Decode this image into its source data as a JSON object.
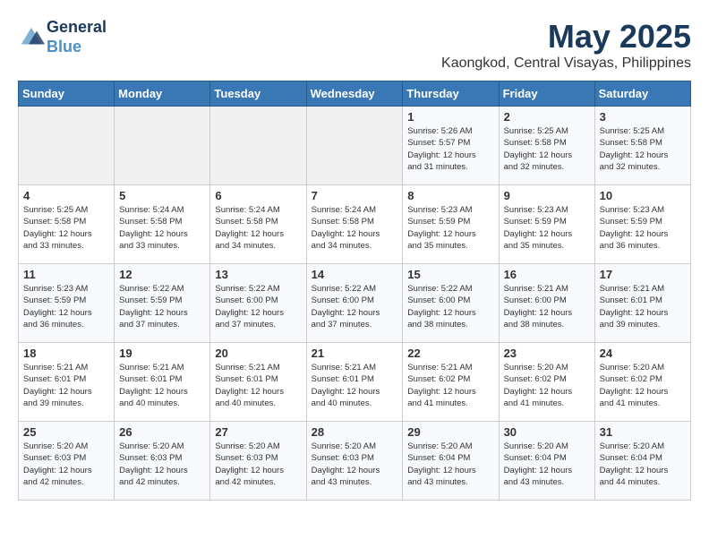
{
  "header": {
    "logo_line1": "General",
    "logo_line2": "Blue",
    "month_title": "May 2025",
    "location": "Kaongkod, Central Visayas, Philippines"
  },
  "weekdays": [
    "Sunday",
    "Monday",
    "Tuesday",
    "Wednesday",
    "Thursday",
    "Friday",
    "Saturday"
  ],
  "weeks": [
    [
      {
        "day": "",
        "info": ""
      },
      {
        "day": "",
        "info": ""
      },
      {
        "day": "",
        "info": ""
      },
      {
        "day": "",
        "info": ""
      },
      {
        "day": "1",
        "info": "Sunrise: 5:26 AM\nSunset: 5:57 PM\nDaylight: 12 hours\nand 31 minutes."
      },
      {
        "day": "2",
        "info": "Sunrise: 5:25 AM\nSunset: 5:58 PM\nDaylight: 12 hours\nand 32 minutes."
      },
      {
        "day": "3",
        "info": "Sunrise: 5:25 AM\nSunset: 5:58 PM\nDaylight: 12 hours\nand 32 minutes."
      }
    ],
    [
      {
        "day": "4",
        "info": "Sunrise: 5:25 AM\nSunset: 5:58 PM\nDaylight: 12 hours\nand 33 minutes."
      },
      {
        "day": "5",
        "info": "Sunrise: 5:24 AM\nSunset: 5:58 PM\nDaylight: 12 hours\nand 33 minutes."
      },
      {
        "day": "6",
        "info": "Sunrise: 5:24 AM\nSunset: 5:58 PM\nDaylight: 12 hours\nand 34 minutes."
      },
      {
        "day": "7",
        "info": "Sunrise: 5:24 AM\nSunset: 5:58 PM\nDaylight: 12 hours\nand 34 minutes."
      },
      {
        "day": "8",
        "info": "Sunrise: 5:23 AM\nSunset: 5:59 PM\nDaylight: 12 hours\nand 35 minutes."
      },
      {
        "day": "9",
        "info": "Sunrise: 5:23 AM\nSunset: 5:59 PM\nDaylight: 12 hours\nand 35 minutes."
      },
      {
        "day": "10",
        "info": "Sunrise: 5:23 AM\nSunset: 5:59 PM\nDaylight: 12 hours\nand 36 minutes."
      }
    ],
    [
      {
        "day": "11",
        "info": "Sunrise: 5:23 AM\nSunset: 5:59 PM\nDaylight: 12 hours\nand 36 minutes."
      },
      {
        "day": "12",
        "info": "Sunrise: 5:22 AM\nSunset: 5:59 PM\nDaylight: 12 hours\nand 37 minutes."
      },
      {
        "day": "13",
        "info": "Sunrise: 5:22 AM\nSunset: 6:00 PM\nDaylight: 12 hours\nand 37 minutes."
      },
      {
        "day": "14",
        "info": "Sunrise: 5:22 AM\nSunset: 6:00 PM\nDaylight: 12 hours\nand 37 minutes."
      },
      {
        "day": "15",
        "info": "Sunrise: 5:22 AM\nSunset: 6:00 PM\nDaylight: 12 hours\nand 38 minutes."
      },
      {
        "day": "16",
        "info": "Sunrise: 5:21 AM\nSunset: 6:00 PM\nDaylight: 12 hours\nand 38 minutes."
      },
      {
        "day": "17",
        "info": "Sunrise: 5:21 AM\nSunset: 6:01 PM\nDaylight: 12 hours\nand 39 minutes."
      }
    ],
    [
      {
        "day": "18",
        "info": "Sunrise: 5:21 AM\nSunset: 6:01 PM\nDaylight: 12 hours\nand 39 minutes."
      },
      {
        "day": "19",
        "info": "Sunrise: 5:21 AM\nSunset: 6:01 PM\nDaylight: 12 hours\nand 40 minutes."
      },
      {
        "day": "20",
        "info": "Sunrise: 5:21 AM\nSunset: 6:01 PM\nDaylight: 12 hours\nand 40 minutes."
      },
      {
        "day": "21",
        "info": "Sunrise: 5:21 AM\nSunset: 6:01 PM\nDaylight: 12 hours\nand 40 minutes."
      },
      {
        "day": "22",
        "info": "Sunrise: 5:21 AM\nSunset: 6:02 PM\nDaylight: 12 hours\nand 41 minutes."
      },
      {
        "day": "23",
        "info": "Sunrise: 5:20 AM\nSunset: 6:02 PM\nDaylight: 12 hours\nand 41 minutes."
      },
      {
        "day": "24",
        "info": "Sunrise: 5:20 AM\nSunset: 6:02 PM\nDaylight: 12 hours\nand 41 minutes."
      }
    ],
    [
      {
        "day": "25",
        "info": "Sunrise: 5:20 AM\nSunset: 6:03 PM\nDaylight: 12 hours\nand 42 minutes."
      },
      {
        "day": "26",
        "info": "Sunrise: 5:20 AM\nSunset: 6:03 PM\nDaylight: 12 hours\nand 42 minutes."
      },
      {
        "day": "27",
        "info": "Sunrise: 5:20 AM\nSunset: 6:03 PM\nDaylight: 12 hours\nand 42 minutes."
      },
      {
        "day": "28",
        "info": "Sunrise: 5:20 AM\nSunset: 6:03 PM\nDaylight: 12 hours\nand 43 minutes."
      },
      {
        "day": "29",
        "info": "Sunrise: 5:20 AM\nSunset: 6:04 PM\nDaylight: 12 hours\nand 43 minutes."
      },
      {
        "day": "30",
        "info": "Sunrise: 5:20 AM\nSunset: 6:04 PM\nDaylight: 12 hours\nand 43 minutes."
      },
      {
        "day": "31",
        "info": "Sunrise: 5:20 AM\nSunset: 6:04 PM\nDaylight: 12 hours\nand 44 minutes."
      }
    ]
  ]
}
